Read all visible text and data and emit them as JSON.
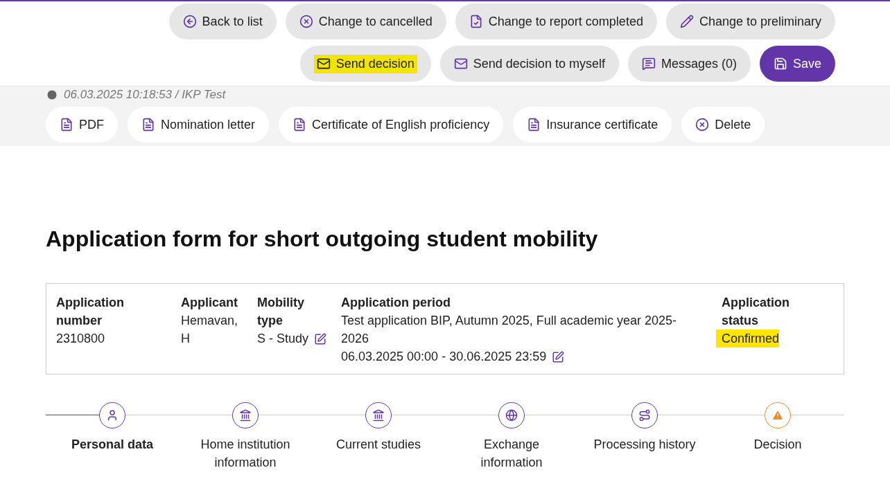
{
  "actions_row_1": [
    {
      "label": "Back to list",
      "highlighted": false,
      "primary": false
    },
    {
      "label": "Change to cancelled",
      "highlighted": false,
      "primary": false
    },
    {
      "label": "Change to report completed",
      "highlighted": false,
      "primary": false
    },
    {
      "label": "Change to preliminary",
      "highlighted": false,
      "primary": false
    }
  ],
  "actions_row_2": [
    {
      "label": "Send decision",
      "highlighted": true,
      "primary": false
    },
    {
      "label": "Send decision to myself",
      "highlighted": false,
      "primary": false
    },
    {
      "label": "Messages (0)",
      "highlighted": false,
      "primary": false
    },
    {
      "label": "Save",
      "highlighted": false,
      "primary": true
    }
  ],
  "timestamp": "06.03.2025 10:18:53 / IKP Test",
  "documents": [
    {
      "label": "PDF",
      "kind": "file"
    },
    {
      "label": "Nomination letter",
      "kind": "file"
    },
    {
      "label": "Certificate of English proficiency",
      "kind": "file"
    },
    {
      "label": "Insurance certificate",
      "kind": "file"
    },
    {
      "label": "Delete",
      "kind": "delete"
    }
  ],
  "title": "Application form for short outgoing student mobility",
  "summary": [
    {
      "label": "Application number",
      "lines": [
        "2310800"
      ],
      "editable": false,
      "highlighted": false
    },
    {
      "label": "Applicant",
      "lines": [
        "Hemavan, H"
      ],
      "editable": false,
      "highlighted": false
    },
    {
      "label": "Mobility type",
      "lines": [
        "S - Study"
      ],
      "editable": true,
      "highlighted": false
    },
    {
      "label": "Application period",
      "lines": [
        "Test application BIP, Autumn 2025, Full academic year 2025-2026",
        "06.03.2025 00:00 - 30.06.2025 23:59"
      ],
      "editable": true,
      "highlighted": false
    },
    {
      "label": "Application status",
      "lines": [
        "Confirmed"
      ],
      "editable": false,
      "highlighted": true
    }
  ],
  "steps": [
    {
      "label": "Personal data",
      "selected": true,
      "warning": false
    },
    {
      "label": "Home institution information",
      "selected": false,
      "warning": false
    },
    {
      "label": "Current studies",
      "selected": false,
      "warning": false
    },
    {
      "label": "Exchange information",
      "selected": false,
      "warning": false
    },
    {
      "label": "Processing history",
      "selected": false,
      "warning": false
    },
    {
      "label": "Decision",
      "selected": false,
      "warning": true
    }
  ]
}
